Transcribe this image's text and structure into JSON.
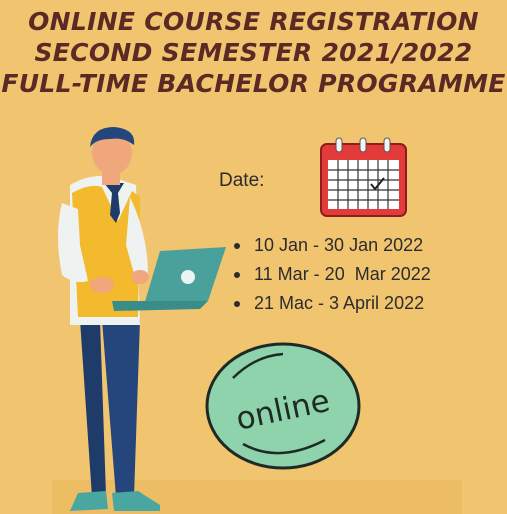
{
  "title": {
    "line1": "ONLINE COURSE REGISTRATION",
    "line2": "SECOND SEMESTER 2021/2022",
    "line3": "FULL-TIME BACHELOR PROGRAMME"
  },
  "date_label": "Date:",
  "dates": [
    "10 Jan - 30 Jan 2022",
    "11 Mar - 20  Mar 2022",
    "21 Mac - 3 April 2022"
  ],
  "badge_text": "online",
  "icons": {
    "calendar": "calendar-icon",
    "person": "person-with-laptop-illustration"
  },
  "colors": {
    "background": "#f1c56f",
    "title": "#5b2a24",
    "calendar_red": "#e33a3a",
    "badge_green": "#8fd3ad"
  }
}
